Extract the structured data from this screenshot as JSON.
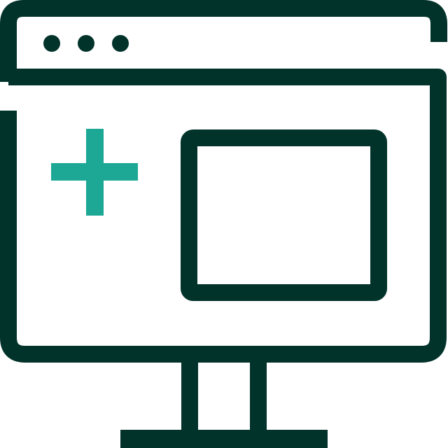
{
  "icon": {
    "name": "add-window-monitor-icon",
    "colors": {
      "outline": "#02332B",
      "accent": "#1DA895",
      "background": "#FFFFFF"
    },
    "parts": [
      "browser-window-frame",
      "window-control-dots",
      "monitor-screen",
      "plus-sign",
      "content-rectangle",
      "monitor-stand"
    ]
  }
}
